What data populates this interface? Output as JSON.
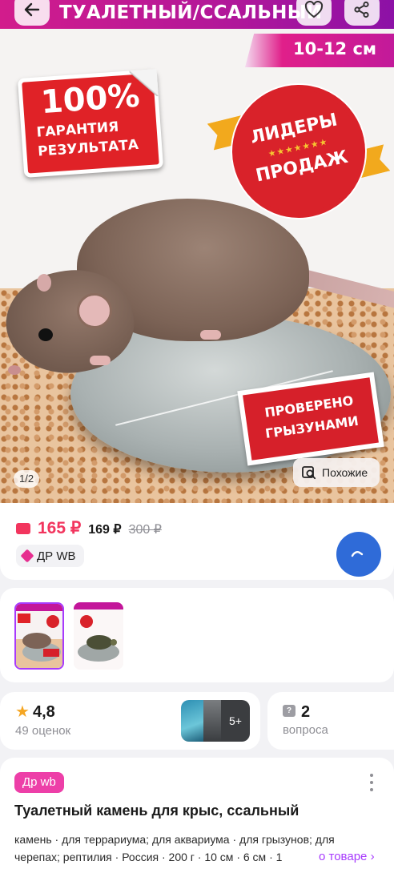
{
  "hero": {
    "banner_text": "ТУАЛЕТНЫЙ/ССАЛЬНЫЙ",
    "size_text": "10-12 см",
    "sticker_big": "100%",
    "sticker_line2": "ГАРАНТИЯ",
    "sticker_line3": "РЕЗУЛЬТАТА",
    "seal_line1": "ЛИДЕРЫ",
    "seal_line2": "ПРОДАЖ",
    "checked_line1": "ПРОВЕРЕНО",
    "checked_line2": "ГРЫЗУНАМИ",
    "counter": "1/2",
    "similar_label": "Похожие"
  },
  "price": {
    "main": "165 ₽",
    "wallet": "169 ₽",
    "old": "300 ₽",
    "chip_label": "ДР WB"
  },
  "rating": {
    "value": "4,8",
    "count": "49 оценок",
    "more_photos": "5+"
  },
  "questions": {
    "value": "2",
    "label": "вопроса"
  },
  "product": {
    "brand_chip": "Др wb",
    "title": "Туалетный камень для крыс, ссальный",
    "tags_line1": "камень · для террариума; для аквариума · для грызунов; для",
    "tags_line2": "черепах; рептилия · Россия · 200 г · 10 см · 6 см · 1",
    "about_link": "о товаре"
  },
  "colors": {
    "accent_pink": "#f2355e",
    "brand_purple": "#a73afd",
    "chip_pink": "#ed3fa8"
  }
}
